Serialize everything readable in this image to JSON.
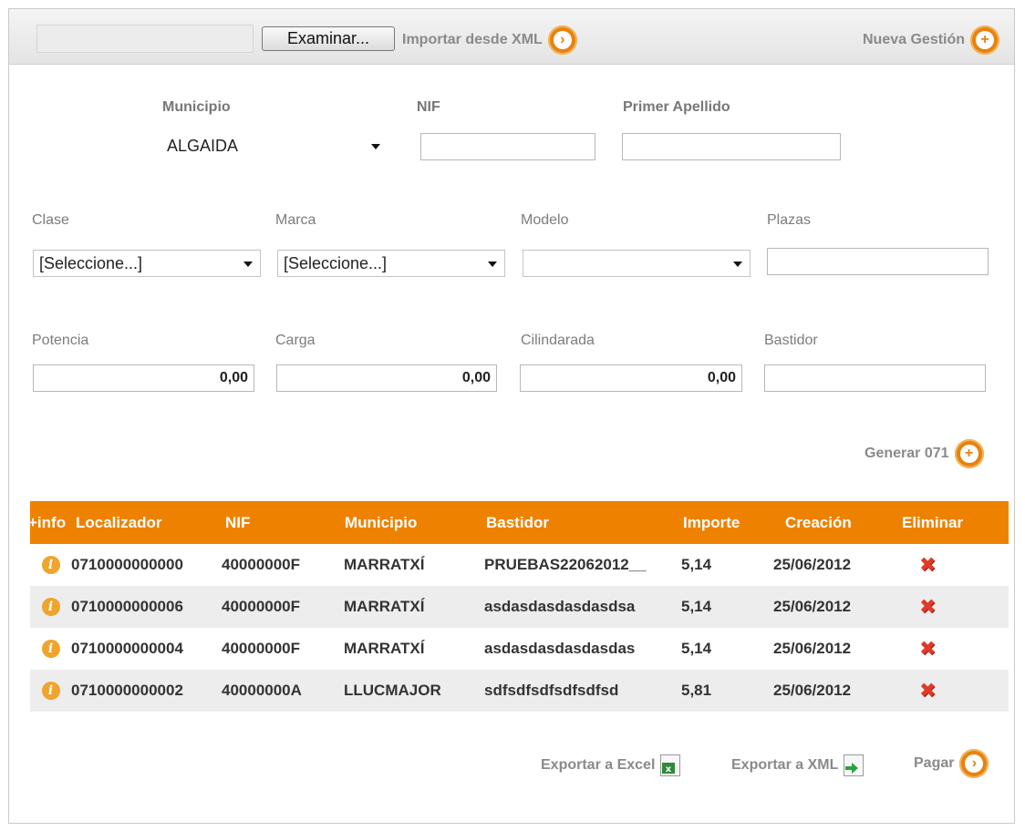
{
  "toolbar": {
    "file_value": "",
    "browse_label": "Examinar...",
    "import_label": "Importar desde XML",
    "new_label": "Nueva Gestión"
  },
  "filters_top": {
    "municipio_label": "Municipio",
    "municipio_value": "ALGAIDA",
    "nif_label": "NIF",
    "nif_value": "",
    "apellido_label": "Primer Apellido",
    "apellido_value": ""
  },
  "filters_mid": {
    "clase_label": "Clase",
    "clase_value": "[Seleccione...]",
    "marca_label": "Marca",
    "marca_value": "[Seleccione...]",
    "modelo_label": "Modelo",
    "modelo_value": "",
    "plazas_label": "Plazas",
    "plazas_value": ""
  },
  "filters_low": {
    "potencia_label": "Potencia",
    "potencia_value": "0,00",
    "carga_label": "Carga",
    "carga_value": "0,00",
    "cilindrada_label": "Cilindarada",
    "cilindrada_value": "0,00",
    "bastidor_label": "Bastidor",
    "bastidor_value": ""
  },
  "generar_label": "Generar 071",
  "table": {
    "headers": [
      "+info",
      "Localizador",
      "NIF",
      "Municipio",
      "Bastidor",
      "Importe",
      "Creación",
      "Eliminar"
    ],
    "rows": [
      {
        "localizador": "0710000000000",
        "nif": "40000000F",
        "municipio": "MARRATXÍ",
        "bastidor": "PRUEBAS22062012__",
        "importe": "5,14",
        "creacion": "25/06/2012"
      },
      {
        "localizador": "0710000000006",
        "nif": "40000000F",
        "municipio": "MARRATXÍ",
        "bastidor": "asdasdasdasdasdsa",
        "importe": "5,14",
        "creacion": "25/06/2012"
      },
      {
        "localizador": "0710000000004",
        "nif": "40000000F",
        "municipio": "MARRATXÍ",
        "bastidor": "asdasdasdasdasdas",
        "importe": "5,14",
        "creacion": "25/06/2012"
      },
      {
        "localizador": "0710000000002",
        "nif": "40000000A",
        "municipio": "LLUCMAJOR",
        "bastidor": "sdfsdfsdfsdfsdfsd",
        "importe": "5,81",
        "creacion": "25/06/2012"
      }
    ]
  },
  "footer": {
    "excel_label": "Exportar a Excel",
    "xml_label": "Exportar a XML",
    "pagar_label": "Pagar"
  },
  "colors": {
    "accent": "#ee8200",
    "delete": "#e03a2a",
    "alt_row": "#ededed"
  }
}
